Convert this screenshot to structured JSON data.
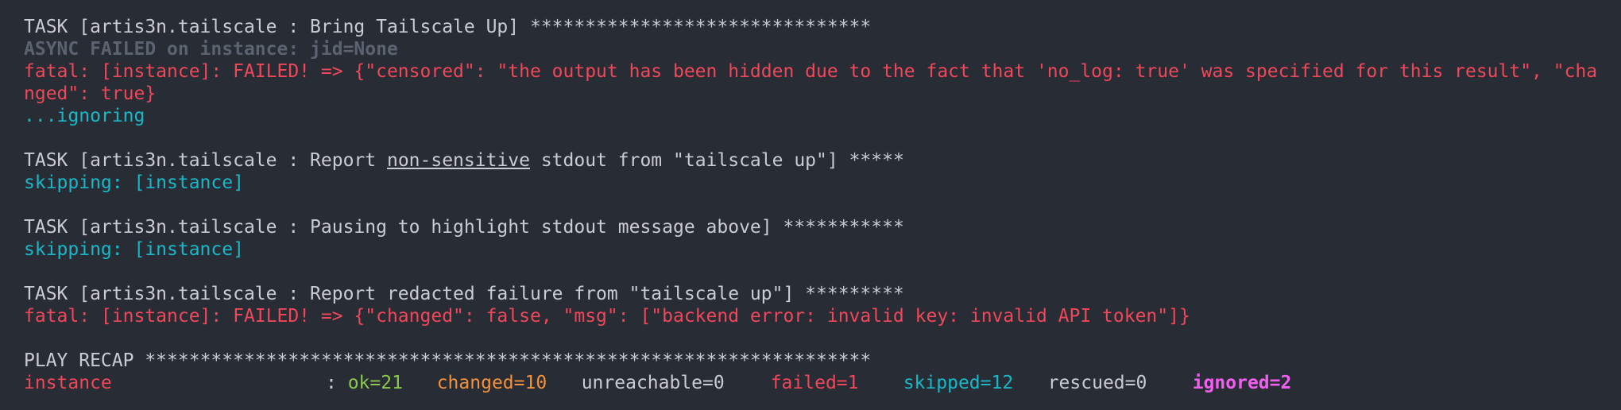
{
  "task1": {
    "header_prefix": "TASK [artis3n.tailscale : Bring Tailscale Up] ",
    "stars": "*******************************",
    "async_failed": "ASYNC FAILED on instance: jid=None",
    "fatal_line1": "fatal: [instance]: FAILED! => {\"censored\": \"the output has been hidden due to the fact that 'no_log: true' was specified for this result\", \"cha",
    "fatal_line2": "nged\": true}",
    "ignoring": "...ignoring"
  },
  "task2": {
    "header_prefix": "TASK [artis3n.tailscale : Report ",
    "underlined": "non-sensitive",
    "header_suffix": " stdout from \"tailscale up\"] ",
    "stars": "*****",
    "status": "skipping: [instance]"
  },
  "task3": {
    "header_prefix": "TASK [artis3n.tailscale : Pausing to highlight stdout message above] ",
    "stars": "***********",
    "status": "skipping: [instance]"
  },
  "task4": {
    "header_prefix": "TASK [artis3n.tailscale : Report redacted failure from \"tailscale up\"] ",
    "stars": "*********",
    "fatal": "fatal: [instance]: FAILED! => {\"changed\": false, \"msg\": [\"backend error: invalid key: invalid API token\"]}"
  },
  "recap": {
    "header_prefix": "PLAY RECAP ",
    "stars": "******************************************************************",
    "host": "instance",
    "colon": ": ",
    "ok": "ok=21",
    "changed": "changed=10",
    "unreachable": "unreachable=0",
    "failed": "failed=1",
    "skipped": "skipped=12",
    "rescued": "rescued=0",
    "ignored": "ignored=2"
  },
  "colors": {
    "background": "#282c34",
    "text": "#c9ccd2",
    "error": "#f0475a",
    "skip": "#18b8c8",
    "ok": "#8cc84c",
    "changed": "#f3913c",
    "ignored": "#f15ef0",
    "dim": "#5b6270"
  }
}
